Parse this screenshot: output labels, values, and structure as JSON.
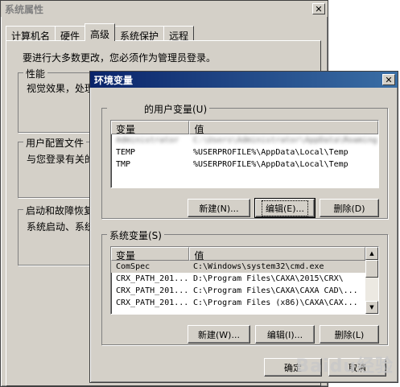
{
  "sysprops": {
    "title": "系统属性",
    "close": "✕",
    "tabs": [
      "计算机名",
      "硬件",
      "高级",
      "系统保护",
      "远程"
    ],
    "admin_note": "要进行大多数更改，您必须作为管理员登录。",
    "performance_label": "性能",
    "performance_text": "视觉效果，处理",
    "profile_label": "用户配置文件",
    "profile_text": "与您登录有关的",
    "startup_label": "启动和故障恢复",
    "startup_text": "系统启动、系统"
  },
  "envvars": {
    "title": "环境变量",
    "close": "✕",
    "user_group_label": "的用户变量(U)",
    "user_header": [
      "变量",
      "值"
    ],
    "user_rows": [
      {
        "name": "Administrator",
        "value": "C:\\Users\\Administrator\\AppData\\Roaming",
        "blurred": true
      },
      {
        "name": "TEMP",
        "value": "%USERPROFILE%\\AppData\\Local\\Temp",
        "blurred": false
      },
      {
        "name": "TMP",
        "value": "%USERPROFILE%\\AppData\\Local\\Temp",
        "blurred": false
      }
    ],
    "user_buttons": {
      "new": "新建(N)...",
      "edit": "编辑(E)...",
      "delete": "删除(D)"
    },
    "sys_group_label": "系统变量(S)",
    "sys_header": [
      "变量",
      "值"
    ],
    "sys_rows": [
      {
        "name": "ComSpec",
        "value": "C:\\Windows\\system32\\cmd.exe"
      },
      {
        "name": "CRX_PATH_201...",
        "value": "D:\\Program Files\\CAXA\\2015\\CRX\\"
      },
      {
        "name": "CRX_PATH_201...",
        "value": "C:\\Program Files\\CAXA\\CAXA CAD\\..."
      },
      {
        "name": "CRX_PATH_201...",
        "value": "C:\\Program Files (x86)\\CAXA\\CAX..."
      }
    ],
    "sys_buttons": {
      "new": "新建(W)...",
      "edit": "编辑(I)...",
      "delete": "删除(L)"
    },
    "ok": "确定",
    "cancel": "取消"
  },
  "watermark": "Baidu经验"
}
